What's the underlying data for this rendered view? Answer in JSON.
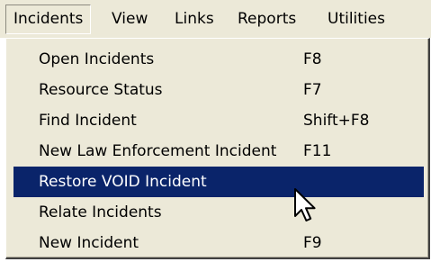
{
  "menubar": {
    "items": [
      {
        "label": "Incidents",
        "active": true
      },
      {
        "label": "View"
      },
      {
        "label": "Links"
      },
      {
        "label": "Reports"
      },
      {
        "label": "Utilities"
      }
    ]
  },
  "dropdown": {
    "items": [
      {
        "label": "Open Incidents",
        "shortcut": "F8"
      },
      {
        "label": "Resource Status",
        "shortcut": "F7"
      },
      {
        "label": "Find Incident",
        "shortcut": "Shift+F8"
      },
      {
        "label": "New Law Enforcement Incident",
        "shortcut": "F11"
      },
      {
        "label": "Restore VOID Incident",
        "shortcut": "",
        "highlighted": true
      },
      {
        "label": "Relate Incidents",
        "shortcut": ""
      },
      {
        "label": "New Incident",
        "shortcut": "F9"
      }
    ]
  },
  "colors": {
    "menu_background": "#ece9d8",
    "highlight_background": "#0a246a",
    "highlight_text": "#ffffff"
  },
  "cursor": {
    "icon": "arrow-pointer-icon"
  }
}
